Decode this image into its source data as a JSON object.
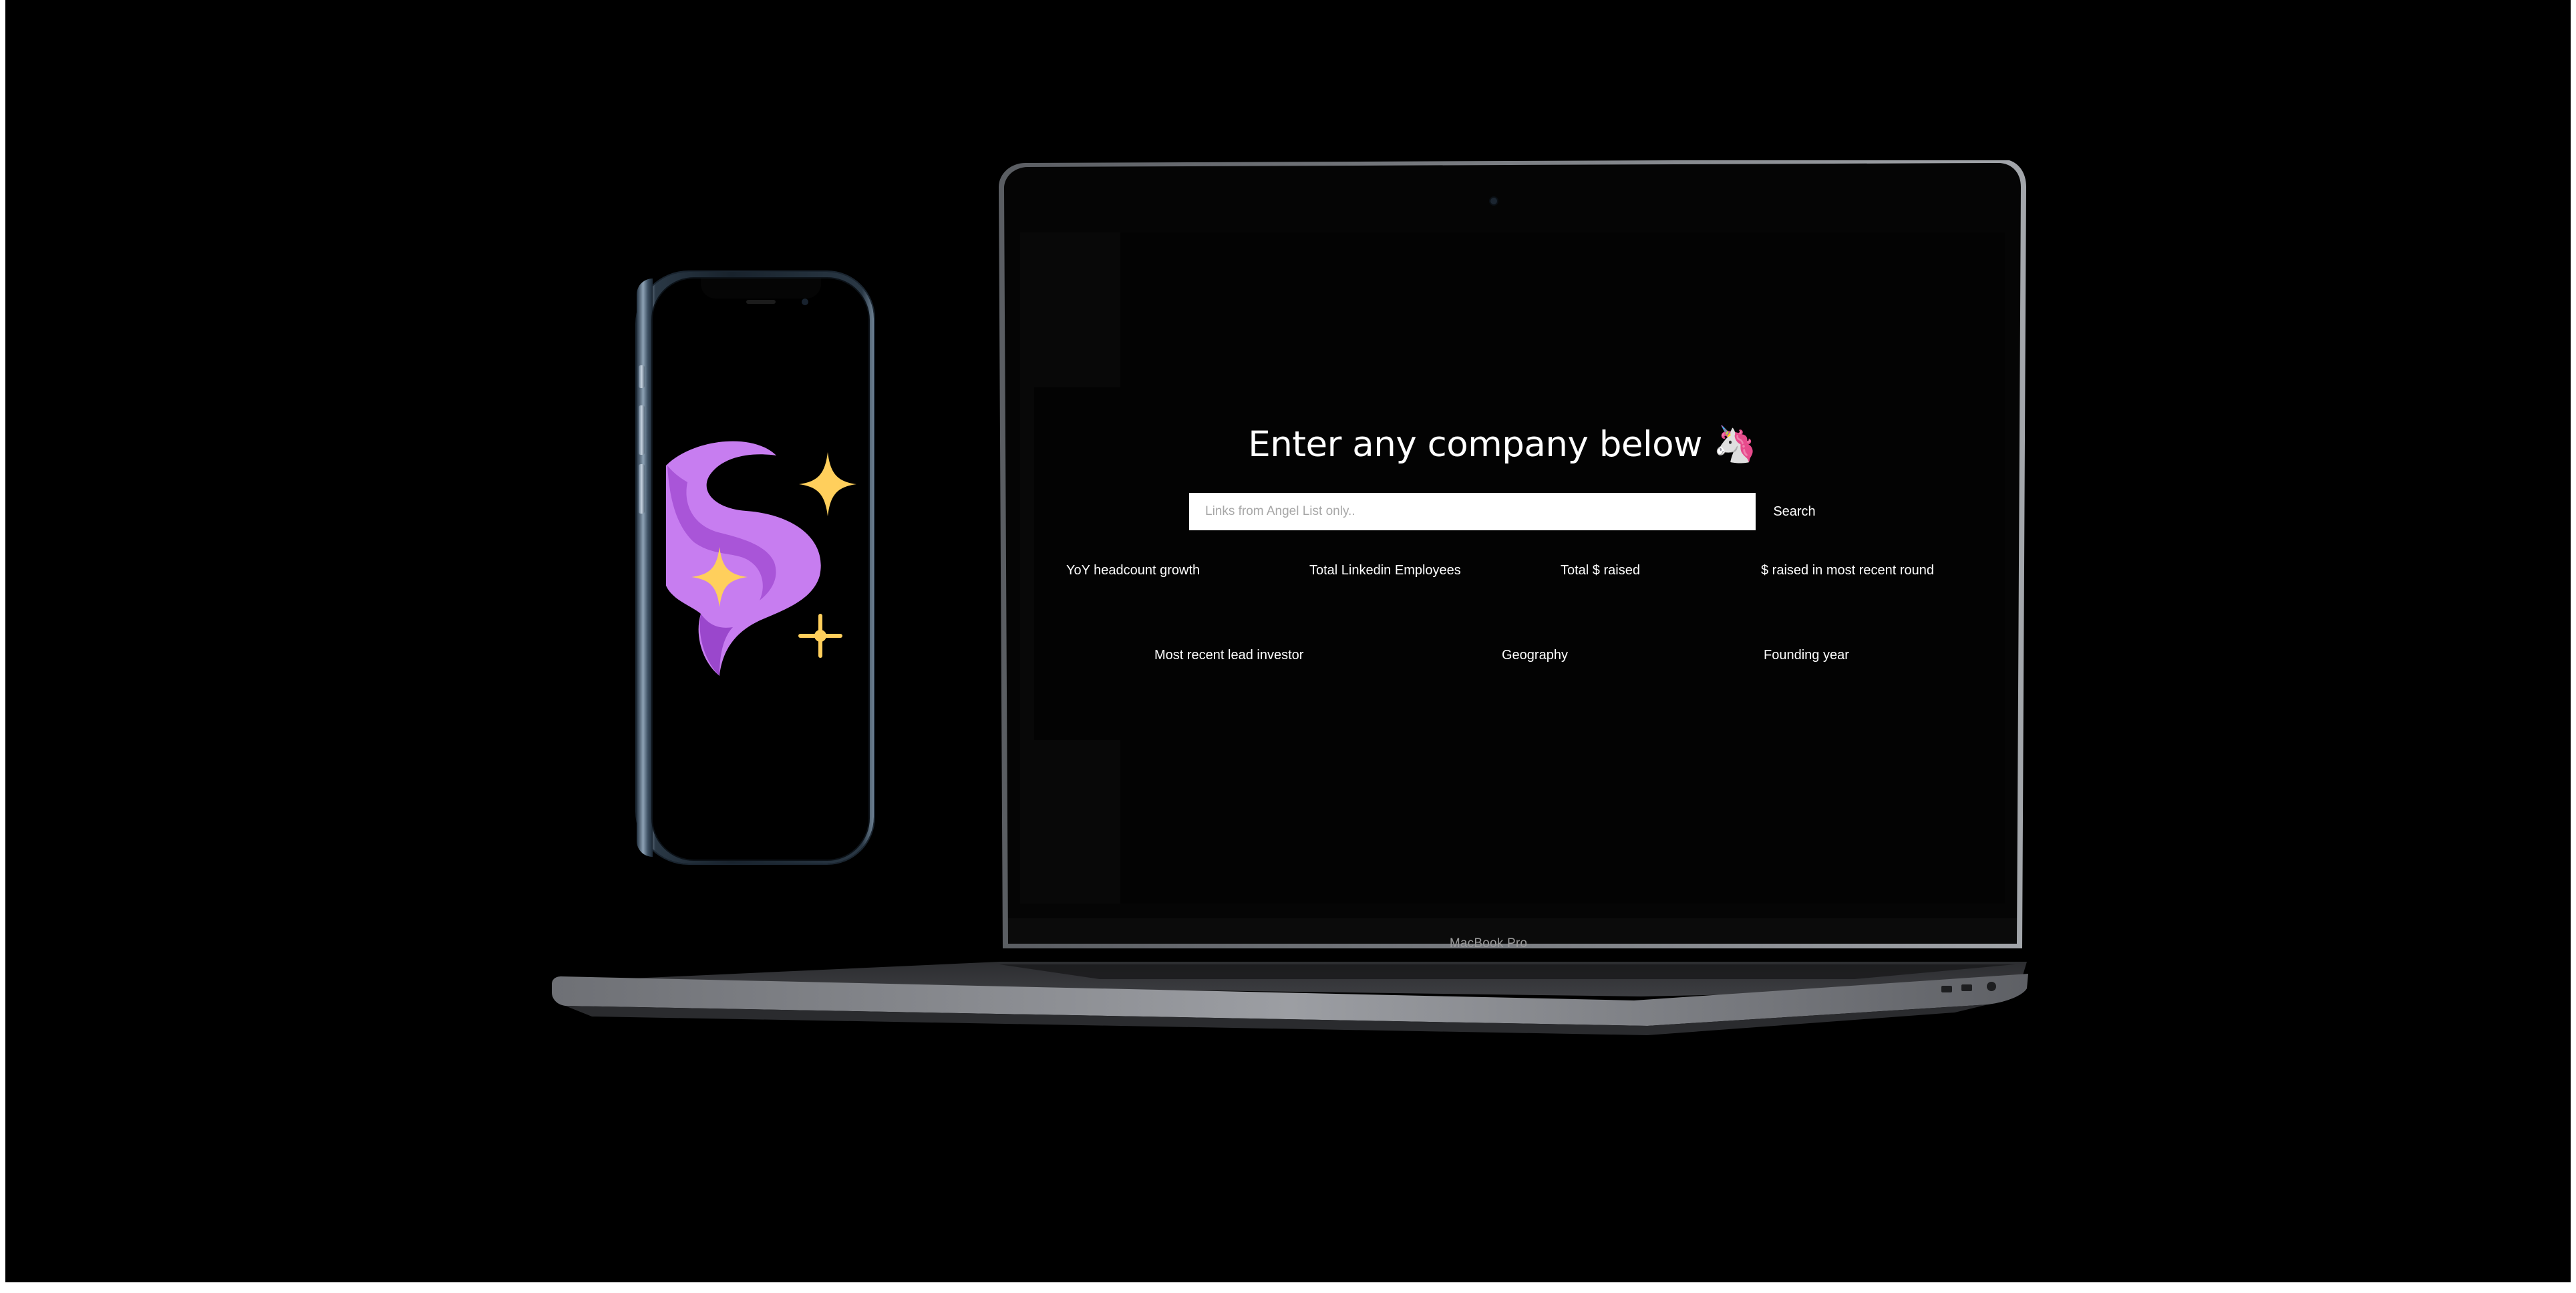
{
  "app": {
    "headline": "Enter any company below 🦄",
    "search": {
      "placeholder": "Links from Angel List only..",
      "value": "",
      "button_label": "Search"
    },
    "metrics_row1": [
      "YoY headcount growth",
      "Total Linkedin Employees",
      "Total $ raised",
      "$ raised in most recent round"
    ],
    "metrics_row2": [
      "Most recent lead investor",
      "Geography",
      "Founding year"
    ]
  },
  "device": {
    "laptop_label": "MacBook Pro"
  },
  "colors": {
    "background": "#000000",
    "phone_art_purple": "#c77df0",
    "phone_art_star": "#ffcf5c"
  }
}
